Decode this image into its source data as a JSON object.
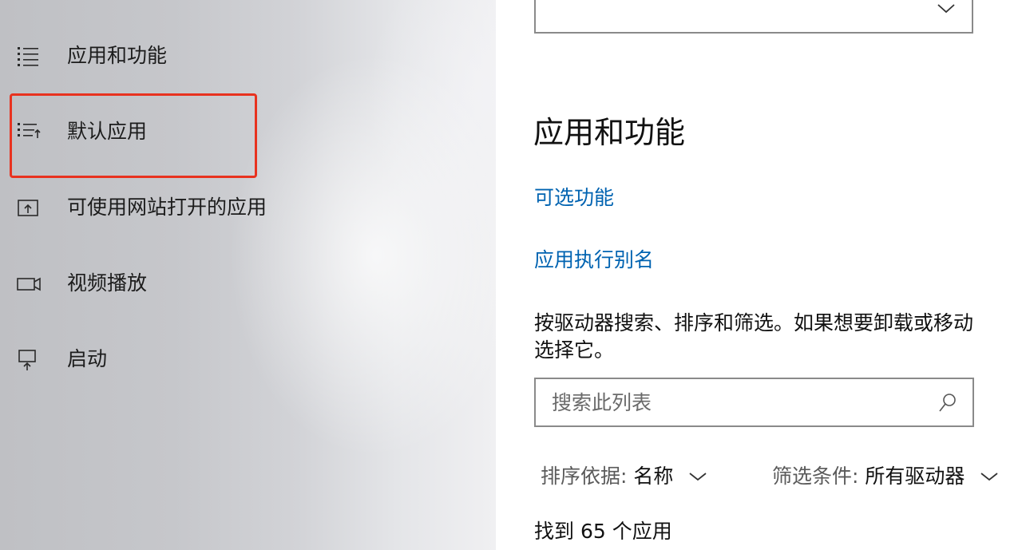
{
  "sidebar": {
    "items": [
      {
        "label": "应用和功能",
        "icon": "apps-list-icon"
      },
      {
        "label": "默认应用",
        "icon": "default-apps-icon"
      },
      {
        "label": "可使用网站打开的应用",
        "icon": "apps-for-websites-icon"
      },
      {
        "label": "视频播放",
        "icon": "video-camera-icon"
      },
      {
        "label": "启动",
        "icon": "startup-icon"
      }
    ],
    "highlight_color": "#e8321f"
  },
  "main": {
    "title": "应用和功能",
    "links": {
      "optional_features": "可选功能",
      "app_execution_aliases": "应用执行别名"
    },
    "description_line1": "按驱动器搜索、排序和筛选。如果想要卸载或移动",
    "description_line2": "选择它。",
    "search": {
      "placeholder": "搜索此列表"
    },
    "sort": {
      "label": "排序依据:",
      "value": "名称"
    },
    "filter": {
      "label": "筛选条件:",
      "value": "所有驱动器"
    },
    "count_text": "找到 65 个应用"
  },
  "colors": {
    "link": "#0063b1",
    "highlight": "#e8321f"
  }
}
